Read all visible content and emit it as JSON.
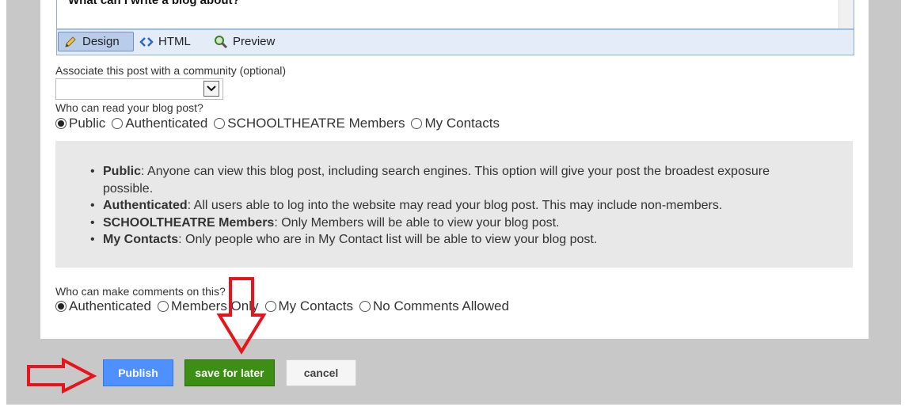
{
  "editor": {
    "visible_text": "What can I write a blog about?",
    "tabs": [
      {
        "label": "Design",
        "icon": "pencil-icon"
      },
      {
        "label": "HTML",
        "icon": "code-icon"
      },
      {
        "label": "Preview",
        "icon": "magnifier-icon"
      }
    ]
  },
  "community": {
    "label": "Associate this post with a community (optional)",
    "selected": ""
  },
  "read_access": {
    "label": "Who can read your blog post?",
    "options": [
      "Public",
      "Authenticated",
      "SCHOOLTHEATRE Members",
      "My Contacts"
    ],
    "selected": "Public"
  },
  "info": [
    {
      "term": "Public",
      "text": ": Anyone can view this blog post, including search engines. This option will give your post the broadest exposure possible."
    },
    {
      "term": "Authenticated",
      "text": ": All users able to log into the website may read your blog post. This may include non-members."
    },
    {
      "term": "SCHOOLTHEATRE Members",
      "text": ": Only Members will be able to view your blog post."
    },
    {
      "term": "My Contacts",
      "text": ": Only people who are in My Contact list will be able to view your blog post."
    }
  ],
  "comments": {
    "label": "Who can make comments on this?",
    "options": [
      "Authenticated",
      "Members Only",
      "My Contacts",
      "No Comments Allowed"
    ],
    "selected": "Authenticated"
  },
  "buttons": {
    "publish": "Publish",
    "save": "save for later",
    "cancel": "cancel"
  },
  "colors": {
    "publish": "#4d90fe",
    "save": "#3d8e14",
    "annotation_arrow": "#e8141b"
  }
}
